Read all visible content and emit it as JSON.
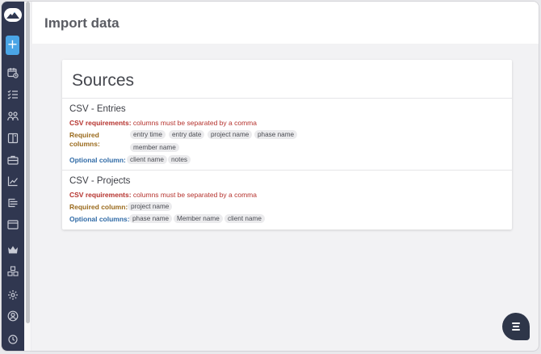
{
  "header": {
    "title": "Import data"
  },
  "card": {
    "title": "Sources",
    "sources": [
      {
        "title": "CSV - Entries",
        "requirements_label": "CSV requirements:",
        "requirements_text": " columns must be separated by a comma",
        "required_label": "Required columns:",
        "required_fields": [
          "entry time",
          "entry date",
          "project name",
          "phase name",
          "member name"
        ],
        "optional_label": "Optional column:",
        "optional_fields": [
          "client name",
          "notes"
        ]
      },
      {
        "title": "CSV - Projects",
        "requirements_label": "CSV requirements:",
        "requirements_text": " columns must be separated by a comma",
        "required_label": "Required column:",
        "required_fields": [
          "project name"
        ],
        "optional_label": "Optional columns:",
        "optional_fields": [
          "phase name",
          "Member name",
          "client name"
        ]
      }
    ]
  },
  "sidebar": {
    "add_label": "+",
    "icons": [
      "calendar-clock-icon",
      "checklist-icon",
      "team-icon",
      "book-icon",
      "briefcase-icon",
      "chart-line-icon",
      "list-tree-icon",
      "folder-icon",
      "crown-icon",
      "boxes-icon",
      "gear-icon",
      "user-circle-icon",
      "history-icon"
    ]
  },
  "colors": {
    "sidebar": "#303750",
    "accent": "#4aa5e6",
    "required_red": "#b5322d",
    "required_label": "#9a6a1c",
    "optional_label": "#2f6aa6"
  }
}
